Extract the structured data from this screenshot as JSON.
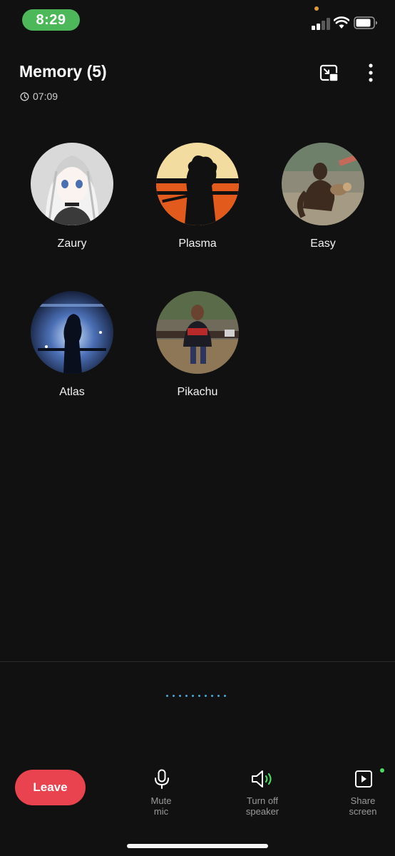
{
  "status_bar": {
    "time": "8:29"
  },
  "header": {
    "title": "Memory (5)",
    "call_duration": "07:09"
  },
  "participants": [
    {
      "name": "Zaury"
    },
    {
      "name": "Plasma"
    },
    {
      "name": "Easy"
    },
    {
      "name": "Atlas"
    },
    {
      "name": "Pikachu"
    }
  ],
  "controls": {
    "leave_label": "Leave",
    "mute_label_line1": "Mute",
    "mute_label_line2": "mic",
    "speaker_label_line1": "Turn off",
    "speaker_label_line2": "speaker",
    "share_label_line1": "Share",
    "share_label_line2": "screen"
  },
  "colors": {
    "background": "#111111",
    "leave_button": "#e8434f",
    "time_pill": "#4cb85a",
    "speaker_wave": "#4cd964",
    "page_dots": "#4aa8d8"
  },
  "icons": [
    "clock-icon",
    "picture-in-picture-icon",
    "more-vertical-icon",
    "microphone-icon",
    "speaker-icon",
    "share-screen-icon",
    "signal-icon",
    "wifi-icon",
    "battery-icon"
  ]
}
